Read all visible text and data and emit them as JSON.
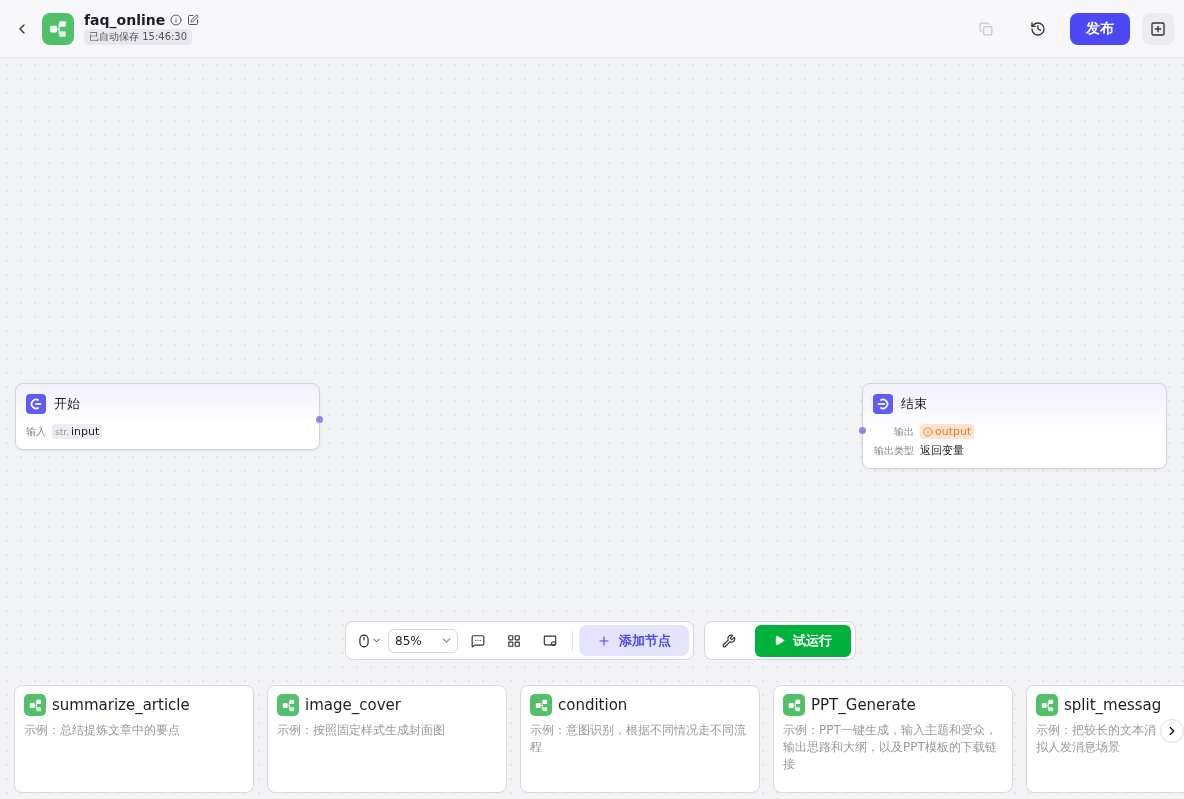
{
  "header": {
    "title": "faq_online",
    "autosave": "已自动保存 15:46:30",
    "publish": "发布"
  },
  "nodes": [
    {
      "kind": "start",
      "title": "开始",
      "fields": [
        {
          "kind": "variable",
          "label": "输入",
          "type": "str.",
          "value": "input"
        }
      ]
    },
    {
      "kind": "end",
      "title": "结束",
      "fields": [
        {
          "kind": "warning",
          "label": "输出",
          "value": "output"
        },
        {
          "kind": "text",
          "label": "输出类型",
          "value": "返回变量"
        }
      ]
    }
  ],
  "toolbar": {
    "zoom": "85%",
    "add_node": "添加节点",
    "test_run": "试运行"
  },
  "templates": [
    {
      "title": "summarize_article",
      "description": "示例：总结提炼文章中的要点"
    },
    {
      "title": "image_cover",
      "description": "示例：按照固定样式生成封面图"
    },
    {
      "title": "condition",
      "description": "示例：意图识别，根据不同情况走不同流程"
    },
    {
      "title": "PPT_Generate",
      "description": "示例：PPT一键生成，输入主题和受众，输出思路和大纲，以及PPT模板的下载链接"
    },
    {
      "title": "split_messag",
      "description_lines": [
        "示例：把较长的文本消",
        "拟人发消息场景"
      ]
    }
  ]
}
